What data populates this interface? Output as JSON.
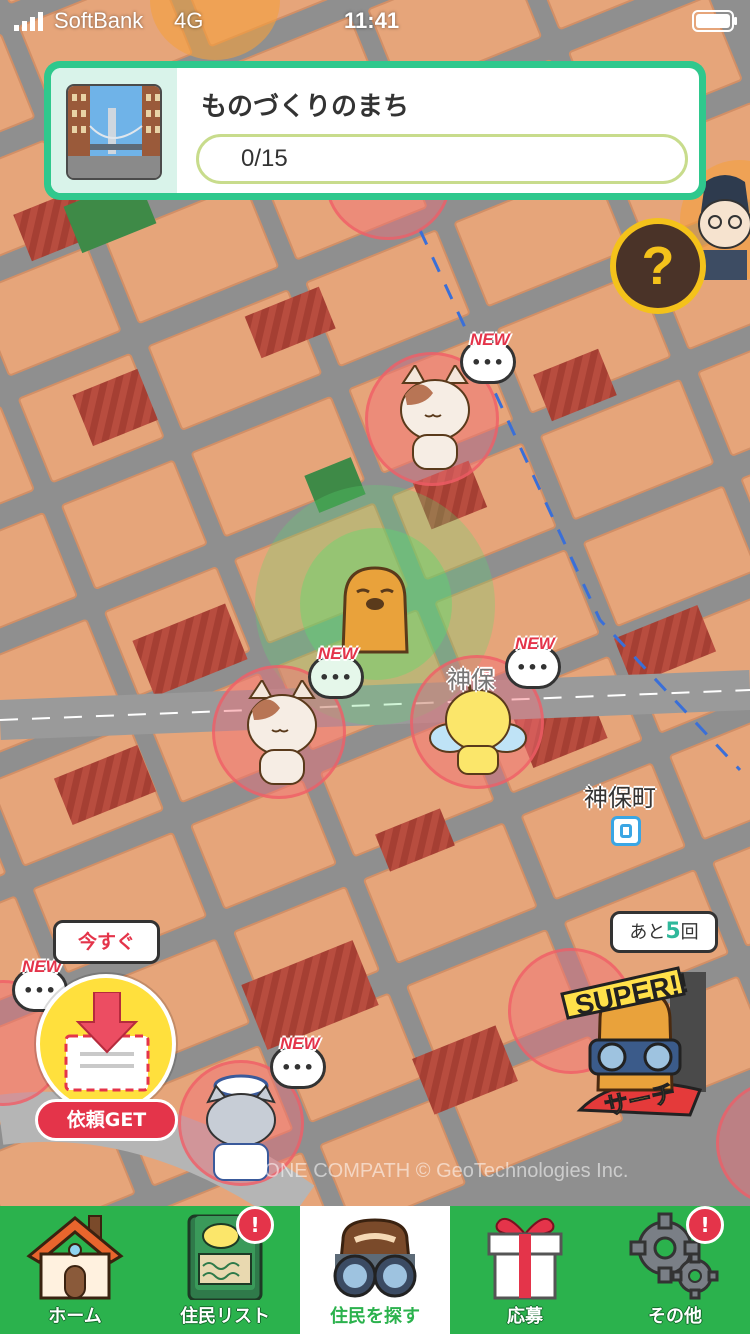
{
  "status_bar": {
    "carrier": "SoftBank",
    "network": "4G",
    "time": "11:41"
  },
  "area_card": {
    "title": "ものづくりのまち",
    "progress": "0/15",
    "progress_fraction": 0
  },
  "help_button": {
    "label": "?"
  },
  "map": {
    "station_label": "神保町",
    "partial_label": "神保",
    "new_tag": "NEW",
    "bubble_text": "•••",
    "copyright": "© ONE COMPATH © GeoTechnologies Inc."
  },
  "request": {
    "badge": "今すぐ",
    "label": "依頼GET"
  },
  "super_search": {
    "remaining_prefix": "あと",
    "remaining_count": "5",
    "remaining_suffix": "回",
    "logo_text": "SUPER!!",
    "logo_sub": "サーチ"
  },
  "tabs": [
    {
      "label": "ホーム",
      "icon": "house-icon",
      "alert": false
    },
    {
      "label": "住民リスト",
      "icon": "resident-book-icon",
      "alert": true,
      "alert_text": "!"
    },
    {
      "label": "住民を探す",
      "icon": "binoculars-icon",
      "alert": false,
      "active": true
    },
    {
      "label": "応募",
      "icon": "gift-icon",
      "alert": false
    },
    {
      "label": "その他",
      "icon": "gear-icon",
      "alert": true,
      "alert_text": "!"
    }
  ],
  "colors": {
    "accent_green": "#2bb24d",
    "card_green": "#2fc88d",
    "alert_red": "#e4344a",
    "help_yellow": "#f4c21b"
  }
}
